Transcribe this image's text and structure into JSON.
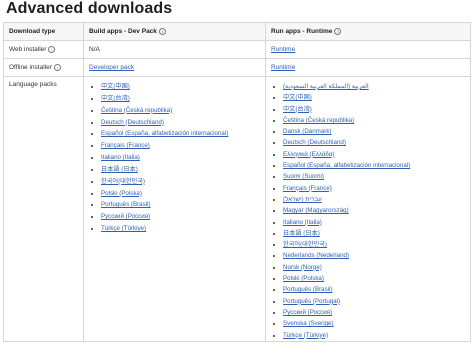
{
  "page": {
    "title": "Advanced downloads"
  },
  "table": {
    "headers": [
      "Download type",
      "Build apps - Dev Pack",
      "Run apps - Runtime"
    ],
    "rows": {
      "web_installer": {
        "label": "Web installer",
        "dev": "N/A",
        "runtime": "Runtime"
      },
      "offline_installer": {
        "label": "Offline installer",
        "dev": "Developer pack",
        "runtime": "Runtime"
      },
      "language_packs": {
        "label": "Language packs"
      }
    },
    "dev_language_packs": [
      "中文(中国)",
      "中文(台湾)",
      "Čeština (Česká republika)",
      "Deutsch (Deutschland)",
      "Español (España, alfabetización internacional)",
      "Français (France)",
      "Italiano (Italia)",
      "日本語 (日本)",
      "한국어(대한민국)",
      "Polski (Polska)",
      "Português (Brasil)",
      "Русский (Россия)",
      "Türkçe (Türkiye)"
    ],
    "runtime_language_packs": [
      "العربية (المملكة العربية السعودية)",
      "中文(中国)",
      "中文(台湾)",
      "Čeština (Česká republika)",
      "Dansk (Danmark)",
      "Deutsch (Deutschland)",
      "Ελληνικά (Ελλάδα)",
      "Español (España, alfabetización internacional)",
      "Suomi (Suomi)",
      "Français (France)",
      "עברית (ישראל)",
      "Magyar (Magyarország)",
      "Italiano (Italia)",
      "日本語 (日本)",
      "한국어(대한민국)",
      "Nederlands (Nederland)",
      "Norsk (Norge)",
      "Polski (Polska)",
      "Português (Brasil)",
      "Português (Portugal)",
      "Русский (Россия)",
      "Svenska (Sverige)",
      "Türkçe (Türkiye)"
    ]
  },
  "colors": {
    "link": "#2e5fb5",
    "border": "#d6d6d6",
    "header_bg": "#f7f7f7"
  },
  "icons": {
    "info": "info-circle-icon"
  }
}
